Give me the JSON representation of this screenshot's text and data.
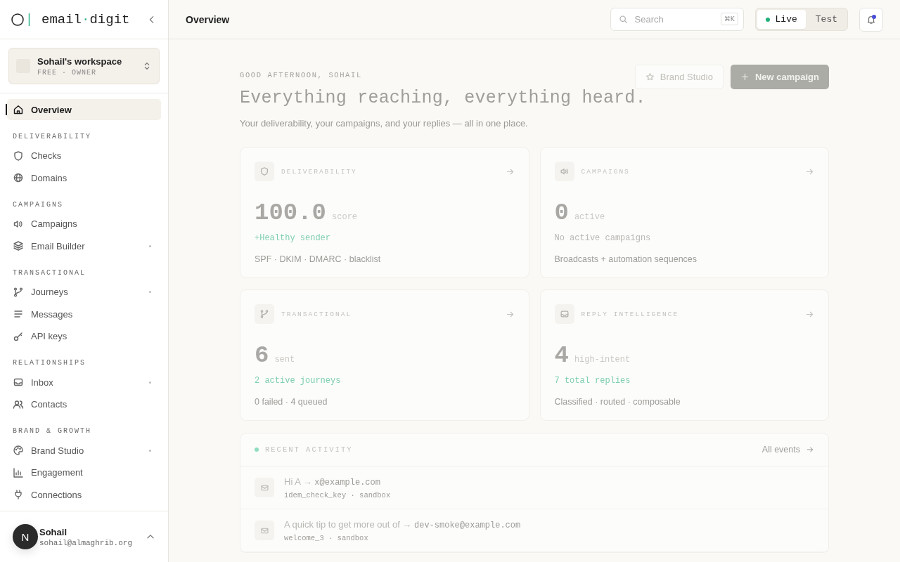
{
  "sidebar": {
    "brand": {
      "left": "email",
      "dot": "·",
      "right": "digit"
    },
    "workspace": {
      "name": "Sohail's workspace",
      "meta": "FREE · OWNER"
    },
    "nav": [
      {
        "label": "Overview",
        "selected": true,
        "dot": false
      }
    ],
    "sections": [
      {
        "heading": "DELIVERABILITY",
        "items": [
          {
            "label": "Checks",
            "selected": false,
            "dot": false
          },
          {
            "label": "Domains",
            "selected": false,
            "dot": false
          }
        ]
      },
      {
        "heading": "CAMPAIGNS",
        "items": [
          {
            "label": "Campaigns",
            "selected": false,
            "dot": false
          },
          {
            "label": "Email Builder",
            "selected": false,
            "dot": true
          }
        ]
      },
      {
        "heading": "TRANSACTIONAL",
        "items": [
          {
            "label": "Journeys",
            "selected": false,
            "dot": true
          },
          {
            "label": "Messages",
            "selected": false,
            "dot": false
          },
          {
            "label": "API keys",
            "selected": false,
            "dot": false
          }
        ]
      },
      {
        "heading": "RELATIONSHIPS",
        "items": [
          {
            "label": "Inbox",
            "selected": false,
            "dot": true
          },
          {
            "label": "Contacts",
            "selected": false,
            "dot": false
          }
        ]
      },
      {
        "heading": "BRAND & GROWTH",
        "items": [
          {
            "label": "Brand Studio",
            "selected": false,
            "dot": true
          },
          {
            "label": "Engagement",
            "selected": false,
            "dot": false
          },
          {
            "label": "Connections",
            "selected": false,
            "dot": false
          }
        ]
      }
    ],
    "user": {
      "avatar": "N",
      "name": "Sohail",
      "email": "sohail@almaghrib.org"
    }
  },
  "topbar": {
    "title": "Overview",
    "search": {
      "placeholder": "Search",
      "shortcut": "⌘K"
    },
    "modes": [
      {
        "label": "Live",
        "selected": true
      },
      {
        "label": "Test",
        "selected": false
      }
    ],
    "notifications": {
      "unread": true
    }
  },
  "hero": {
    "greeting": "GOOD AFTERNOON, SOHAIL",
    "headline": "Everything reaching, everything heard.",
    "subtitle": "Your deliverability, your campaigns, and your replies — all in one place.",
    "actions": [
      {
        "label": "Brand Studio",
        "kind": "secondary"
      },
      {
        "label": "New campaign",
        "kind": "primary"
      }
    ]
  },
  "cards": [
    {
      "title": "DELIVERABILITY",
      "value": "100.0",
      "unit": "score",
      "status": "+Healthy sender",
      "color": "#7fcfb0",
      "note": "SPF · DKIM · DMARC · blacklist"
    },
    {
      "title": "CAMPAIGNS",
      "value": "0",
      "unit": "active",
      "status": "No active campaigns",
      "color": "#b9b7b2",
      "note": "Broadcasts + automation sequences"
    },
    {
      "title": "TRANSACTIONAL",
      "value": "6",
      "unit": "sent",
      "status": "2 active journeys",
      "color": "#7fcfb0",
      "note": "0 failed · 4 queued"
    },
    {
      "title": "REPLY INTELLIGENCE",
      "value": "4",
      "unit": "high-intent",
      "status": "7 total replies",
      "color": "#7fcfb0",
      "note": "Classified · routed · composable"
    }
  ],
  "activity": {
    "title": "RECENT ACTIVITY",
    "link": "All events",
    "rows": [
      {
        "subject": "Hi A",
        "arrow": "→",
        "recipient": "x@example.com",
        "meta": "idem_check_key · sandbox"
      },
      {
        "subject": "A quick tip to get more out of",
        "arrow": "→",
        "recipient": "dev-smoke@example.com",
        "meta": "welcome_3 · sandbox"
      }
    ]
  }
}
